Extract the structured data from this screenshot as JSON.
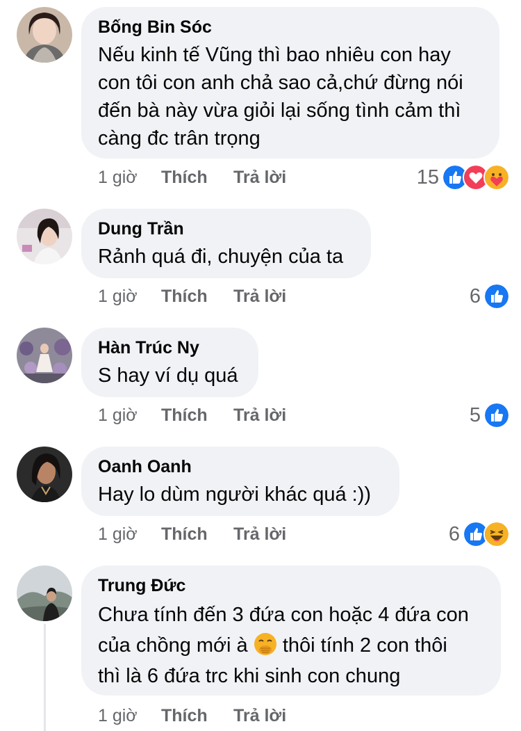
{
  "comments": [
    {
      "author": "Bống Bin Sóc",
      "text_lines": [
        "Nếu kinh tế Vũng thì bao nhiêu con hay",
        "con tôi con anh chả sao cả,chứ đừng nói",
        "đến bà này vừa giỏi lại sống tình cảm thì",
        "càng đc trân trọng"
      ],
      "time": "1 giờ",
      "like": "Thích",
      "reply": "Trả lời",
      "reaction_count": "15",
      "reactions": [
        "like-icon",
        "love-icon",
        "care-icon"
      ]
    },
    {
      "author": "Dung Trần",
      "text_lines": [
        "Rảnh quá đi, chuyện của ta"
      ],
      "time": "1 giờ",
      "like": "Thích",
      "reply": "Trả lời",
      "reaction_count": "6",
      "reactions": [
        "like-icon"
      ]
    },
    {
      "author": "Hàn Trúc Ny",
      "text_lines": [
        "S hay ví dụ quá"
      ],
      "time": "1 giờ",
      "like": "Thích",
      "reply": "Trả lời",
      "reaction_count": "5",
      "reactions": [
        "like-icon"
      ]
    },
    {
      "author": "Oanh Oanh",
      "text_lines": [
        "Hay lo dùm người khác quá :))"
      ],
      "time": "1 giờ",
      "like": "Thích",
      "reply": "Trả lời",
      "reaction_count": "6",
      "reactions": [
        "like-icon",
        "haha-icon"
      ]
    },
    {
      "author": "Trung Đức",
      "text_lines": [
        "Chưa tính đến 3 đứa con hoặc 4 đứa con",
        "của chồng mới à",
        "thôi tính 2 con thôi",
        "thì là 6 đứa trc khi sinh con chung"
      ],
      "inline_emoji": "hand-over-mouth-emoji",
      "time": "1 giờ",
      "like": "Thích",
      "reply": "Trả lời"
    }
  ],
  "colors": {
    "like_blue": "#1877f2",
    "love_red": "#f33e58",
    "bubble_bg": "#f0f2f5",
    "meta_gray": "#65676b"
  }
}
